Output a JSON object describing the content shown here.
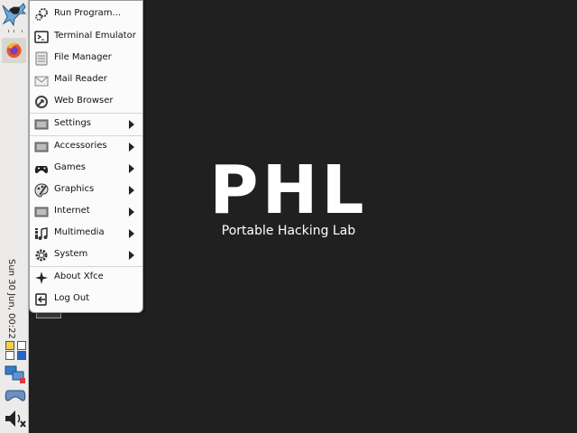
{
  "menu": {
    "items": [
      {
        "label": "Run Program...",
        "icon": "gears-icon",
        "submenu": false
      },
      {
        "label": "Terminal Emulator",
        "icon": "terminal-icon",
        "submenu": false
      },
      {
        "label": "File Manager",
        "icon": "file-manager-icon",
        "submenu": false
      },
      {
        "label": "Mail Reader",
        "icon": "mail-icon",
        "submenu": false
      },
      {
        "label": "Web Browser",
        "icon": "web-browser-icon",
        "submenu": false
      },
      {
        "label": "Settings",
        "icon": "settings-icon",
        "submenu": true
      },
      {
        "label": "Accessories",
        "icon": "accessories-icon",
        "submenu": true
      },
      {
        "label": "Games",
        "icon": "gamepad-icon",
        "submenu": true
      },
      {
        "label": "Graphics",
        "icon": "palette-icon",
        "submenu": true
      },
      {
        "label": "Internet",
        "icon": "internet-icon",
        "submenu": true
      },
      {
        "label": "Multimedia",
        "icon": "music-icon",
        "submenu": true
      },
      {
        "label": "System",
        "icon": "gear-icon",
        "submenu": true
      },
      {
        "label": "About Xfce",
        "icon": "sparkle-icon",
        "submenu": false
      },
      {
        "label": "Log Out",
        "icon": "logout-icon",
        "submenu": false
      }
    ]
  },
  "panel": {
    "clock": "Sun 30 Jun, 00:22"
  },
  "desktop": {
    "logo_title": "PHL",
    "logo_subtitle": "Portable Hacking Lab"
  },
  "colors": {
    "desktop_bg": "#202020",
    "panel_bg": "#ecebe9",
    "menu_bg": "#fbfbfb"
  }
}
